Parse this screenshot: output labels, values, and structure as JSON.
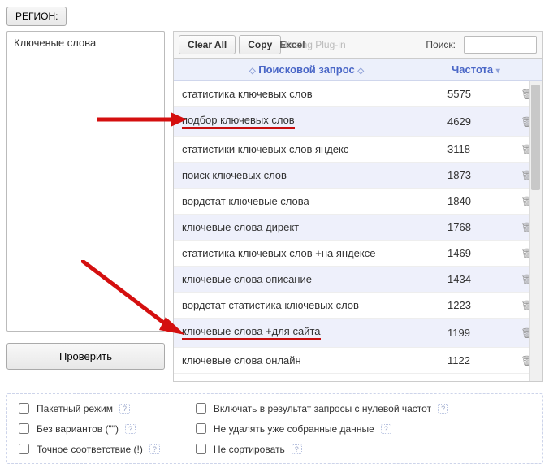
{
  "region_button": "РЕГИОН:",
  "keywords_label": "Ключевые слова",
  "check_button": "Проверить",
  "toolbar": {
    "clear_all": "Clear All",
    "copy": "Copy",
    "ghost": "Missing Plug-in",
    "excel_overlay": "Excel",
    "search_label": "Поиск:"
  },
  "columns": {
    "query": "Поисковой запрос",
    "freq": "Частота"
  },
  "rows": [
    {
      "q": "статистика ключевых слов",
      "f": 5575,
      "hl": false
    },
    {
      "q": "подбор ключевых слов",
      "f": 4629,
      "hl": true
    },
    {
      "q": "статистики ключевых слов яндекс",
      "f": 3118,
      "hl": false
    },
    {
      "q": "поиск ключевых слов",
      "f": 1873,
      "hl": false
    },
    {
      "q": "вордстат ключевые слова",
      "f": 1840,
      "hl": false
    },
    {
      "q": "ключевые слова директ",
      "f": 1768,
      "hl": false
    },
    {
      "q": "статистика ключевых слов +на яндексе",
      "f": 1469,
      "hl": false
    },
    {
      "q": "ключевые слова описание",
      "f": 1434,
      "hl": false
    },
    {
      "q": "вордстат статистика ключевых слов",
      "f": 1223,
      "hl": false
    },
    {
      "q": "ключевые слова +для сайта",
      "f": 1199,
      "hl": true
    },
    {
      "q": "ключевые слова онлайн",
      "f": 1122,
      "hl": false
    }
  ],
  "options": {
    "left": [
      "Пакетный режим",
      "Без вариантов (\"\")",
      "Точное соответствие (!)"
    ],
    "right": [
      "Включать в результат запросы с нулевой частот",
      "Не удалять уже собранные данные",
      "Не сортировать"
    ]
  },
  "help_char": "?"
}
